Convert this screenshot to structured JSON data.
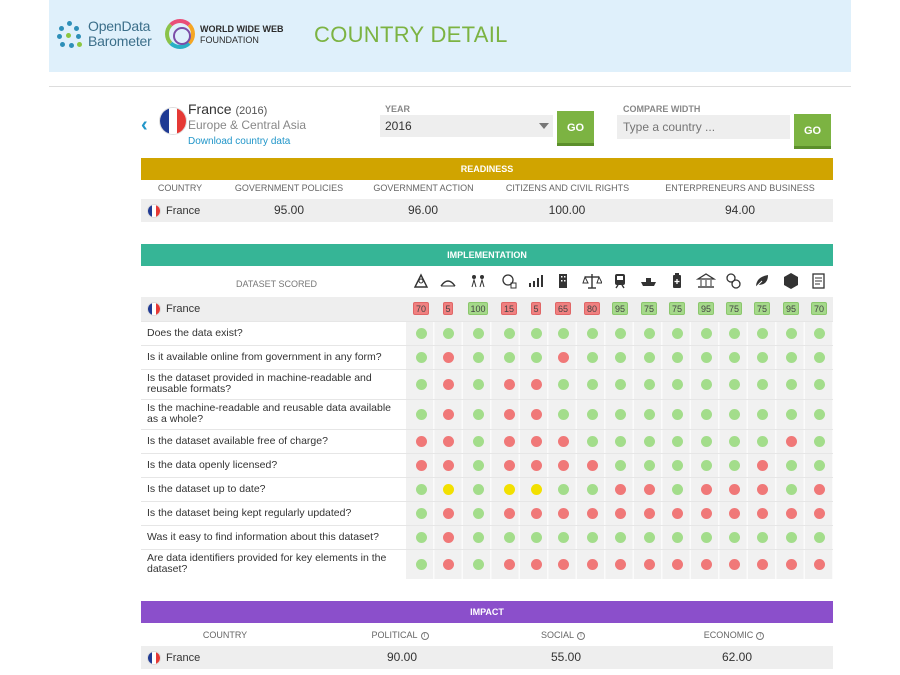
{
  "header": {
    "odb_logo_line1": "OpenData",
    "odb_logo_line2": "Barometer",
    "www_logo_line1": "WORLD WIDE WEB",
    "www_logo_line2": "FOUNDATION",
    "page_title": "COUNTRY DETAIL"
  },
  "country": {
    "name": "France",
    "year_suffix": "(2016)",
    "region": "Europe & Central Asia",
    "download_link": "Download country data"
  },
  "controls": {
    "year_label": "YEAR",
    "year_value": "2016",
    "go_label": "GO",
    "compare_label": "COMPARE WIDTH",
    "compare_placeholder": "Type a country ..."
  },
  "readiness": {
    "title": "READINESS",
    "columns": [
      "COUNTRY",
      "GOVERNMENT POLICIES",
      "GOVERNMENT ACTION",
      "CITIZENS AND CIVIL RIGHTS",
      "ENTERPRENEURS AND BUSINESS"
    ],
    "row": {
      "country": "France",
      "values": [
        "95.00",
        "96.00",
        "100.00",
        "94.00"
      ]
    }
  },
  "implementation": {
    "title": "IMPLEMENTATION",
    "dataset_label": "DATASET SCORED",
    "icons": [
      "map-icon",
      "land-icon",
      "crowd-icon",
      "budget-icon",
      "statistics-icon",
      "building-icon",
      "legal-icon",
      "transport-icon",
      "trade-icon",
      "health-icon",
      "institution-icon",
      "education-icon",
      "environment-icon",
      "box-icon",
      "document-icon"
    ],
    "country": "France",
    "scores": [
      {
        "value": "70",
        "status": "red"
      },
      {
        "value": "5",
        "status": "red"
      },
      {
        "value": "100",
        "status": "green"
      },
      {
        "value": "15",
        "status": "red"
      },
      {
        "value": "5",
        "status": "red"
      },
      {
        "value": "65",
        "status": "red"
      },
      {
        "value": "80",
        "status": "red"
      },
      {
        "value": "95",
        "status": "green"
      },
      {
        "value": "75",
        "status": "green"
      },
      {
        "value": "75",
        "status": "green"
      },
      {
        "value": "95",
        "status": "green"
      },
      {
        "value": "75",
        "status": "green"
      },
      {
        "value": "75",
        "status": "green"
      },
      {
        "value": "95",
        "status": "green"
      },
      {
        "value": "70",
        "status": "green"
      }
    ],
    "questions": [
      {
        "text": "Does the data exist?",
        "dots": "ggggggggggggggg"
      },
      {
        "text": "Is it available online from government in any form?",
        "dots": "grgggrggggggggg"
      },
      {
        "text": "Is the dataset provided in machine-readable and reusable formats?",
        "dots": "grgrrgggggggggg"
      },
      {
        "text": "Is the machine-readable and reusable data available as a whole?",
        "dots": "grgrrgggggggggg"
      },
      {
        "text": "Is the dataset available free of charge?",
        "dots": "rrgrrrgggggggrg"
      },
      {
        "text": "Is the data openly licensed?",
        "dots": "rrgrrrrgggggrgg"
      },
      {
        "text": "Is the dataset up to date?",
        "dots": "gygyyggrrgrrrgr"
      },
      {
        "text": "Is the dataset being kept regularly updated?",
        "dots": "grgrrrrrrrrrrrr"
      },
      {
        "text": "Was it easy to find information about this dataset?",
        "dots": "grgggggggggggggr"
      },
      {
        "text": "Are data identifiers provided for key elements in the dataset?",
        "dots": "grgrrrrrrrrrrrr"
      }
    ]
  },
  "impact": {
    "title": "IMPACT",
    "columns": [
      "COUNTRY",
      "POLITICAL",
      "SOCIAL",
      "ECONOMIC"
    ],
    "info_icon": "i",
    "row": {
      "country": "France",
      "values": [
        "90.00",
        "55.00",
        "62.00"
      ]
    }
  },
  "colors": {
    "readiness": "#d0a400",
    "implementation": "#36b596",
    "impact": "#8b4fcb",
    "go_button": "#7cb342",
    "title_green": "#7cb342"
  }
}
